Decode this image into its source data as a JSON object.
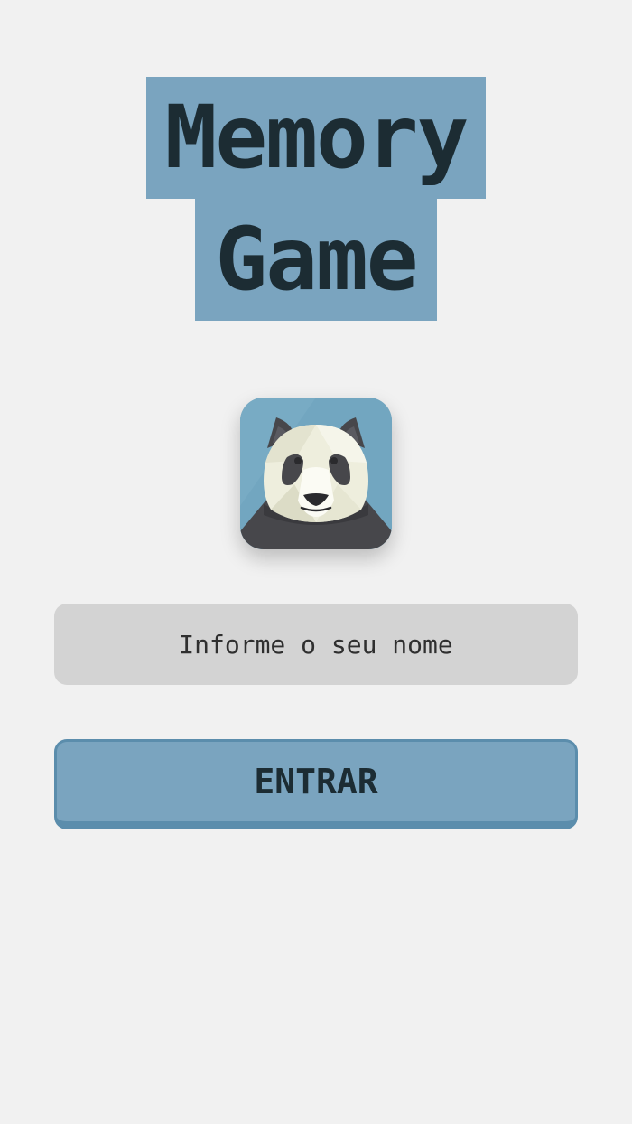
{
  "title": {
    "line1": "Memory",
    "line2": "Game"
  },
  "logo": {
    "icon": "panda-icon"
  },
  "name_input": {
    "value": "",
    "placeholder": "Informe o seu nome"
  },
  "enter_button": {
    "label": "ENTRAR"
  },
  "colors": {
    "background": "#f1f1f1",
    "accent": "#7aa4bf",
    "accent_border": "#5b8dac",
    "title_text": "#1c2c33",
    "input_background": "#d3d3d3"
  }
}
